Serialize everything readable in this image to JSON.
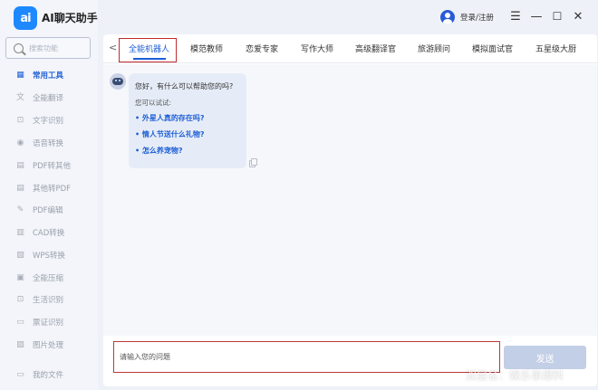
{
  "app": {
    "logo_text": "ai",
    "title": "AI聊天助手"
  },
  "sidebar": {
    "search_placeholder": "搜索功能",
    "items": [
      {
        "label": "常用工具",
        "icon": "grid-icon",
        "glyph": "▦",
        "active": true
      },
      {
        "label": "全能翻译",
        "icon": "translate-icon",
        "glyph": "文"
      },
      {
        "label": "文字识别",
        "icon": "scan-text-icon",
        "glyph": "⊡"
      },
      {
        "label": "语音转换",
        "icon": "audio-icon",
        "glyph": "◉"
      },
      {
        "label": "PDF转其他",
        "icon": "pdf-convert-icon",
        "glyph": "▤"
      },
      {
        "label": "其他转PDF",
        "icon": "to-pdf-icon",
        "glyph": "▤"
      },
      {
        "label": "PDF编辑",
        "icon": "pdf-edit-icon",
        "glyph": "✎"
      },
      {
        "label": "CAD转换",
        "icon": "cad-icon",
        "glyph": "▥"
      },
      {
        "label": "WPS转换",
        "icon": "wps-icon",
        "glyph": "▧"
      },
      {
        "label": "全能压缩",
        "icon": "compress-icon",
        "glyph": "▣"
      },
      {
        "label": "生活识别",
        "icon": "life-scan-icon",
        "glyph": "⊡"
      },
      {
        "label": "票证识别",
        "icon": "ticket-scan-icon",
        "glyph": "▭"
      },
      {
        "label": "图片处理",
        "icon": "image-icon",
        "glyph": "▨"
      }
    ],
    "files_label": "我的文件"
  },
  "topbar": {
    "login_label": "登录/注册",
    "menu_glyph": "☰",
    "minimize_glyph": "—",
    "maximize_glyph": "☐",
    "close_glyph": "✕"
  },
  "tabs": {
    "prev_glyph": "<",
    "items": [
      "全能机器人",
      "模范教师",
      "恋爱专家",
      "写作大师",
      "高级翻译官",
      "旅游顾问",
      "模拟面试官",
      "五星级大厨"
    ],
    "active_index": 0
  },
  "chat": {
    "greeting": "您好，有什么可以帮助您的吗?",
    "try_label": "您可以试试:",
    "suggestions": [
      "外星人真的存在吗?",
      "情人节送什么礼物?",
      "怎么养宠物?"
    ]
  },
  "composer": {
    "placeholder": "请输入您的问题",
    "send_label": "发送"
  },
  "watermark": "双层名：娱乐事爆料",
  "colors": {
    "accent": "#1e5fd6",
    "highlight_border": "#c22b2b",
    "send_disabled": "#c3cfe6"
  }
}
